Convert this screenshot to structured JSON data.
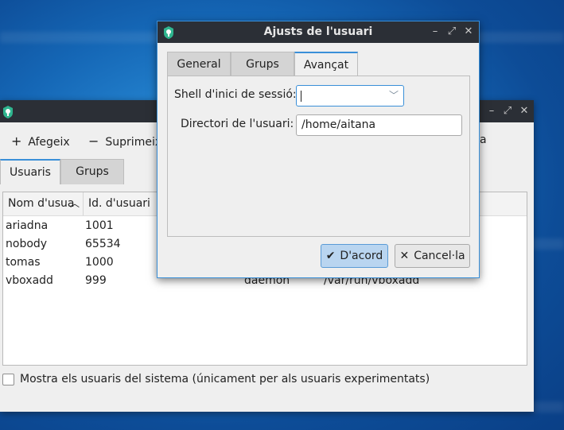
{
  "main_window": {
    "toolbar": {
      "add_label": "Afegeix",
      "delete_label": "Suprimeix",
      "partial_right_label": "a"
    },
    "tabs": [
      {
        "label": "Usuaris",
        "active": true
      },
      {
        "label": "Grups",
        "active": false
      }
    ],
    "table": {
      "columns": [
        "Nom d'usua",
        "Id. d'usuari"
      ],
      "rows": [
        {
          "name": "ariadna",
          "uid": "1001",
          "group": "",
          "home": ""
        },
        {
          "name": "nobody",
          "uid": "65534",
          "group": "",
          "home": ""
        },
        {
          "name": "tomas",
          "uid": "1000",
          "group": "",
          "home": ""
        },
        {
          "name": "vboxadd",
          "uid": "999",
          "group": "daemon",
          "home": "/var/run/vboxadd"
        }
      ]
    },
    "show_system_users": {
      "label": "Mostra els usuaris del sistema (únicament per als usuaris experimentats)",
      "checked": false
    }
  },
  "dialog": {
    "title": "Ajusts de l'usuari",
    "tabs": [
      {
        "label": "General",
        "active": false
      },
      {
        "label": "Grups",
        "active": false
      },
      {
        "label": "Avançat",
        "active": true
      }
    ],
    "shell_label": "Shell d'inici de sessió:",
    "shell_value": "",
    "home_label": "Directori de l'usuari:",
    "home_value": "/home/aitana",
    "ok_label": "D'acord",
    "cancel_label": "Cancel·la"
  },
  "colors": {
    "accent": "#3a8fd8",
    "titlebar": "#2b2f36",
    "window_bg": "#efefef",
    "app_icon": "#2fb58f"
  }
}
